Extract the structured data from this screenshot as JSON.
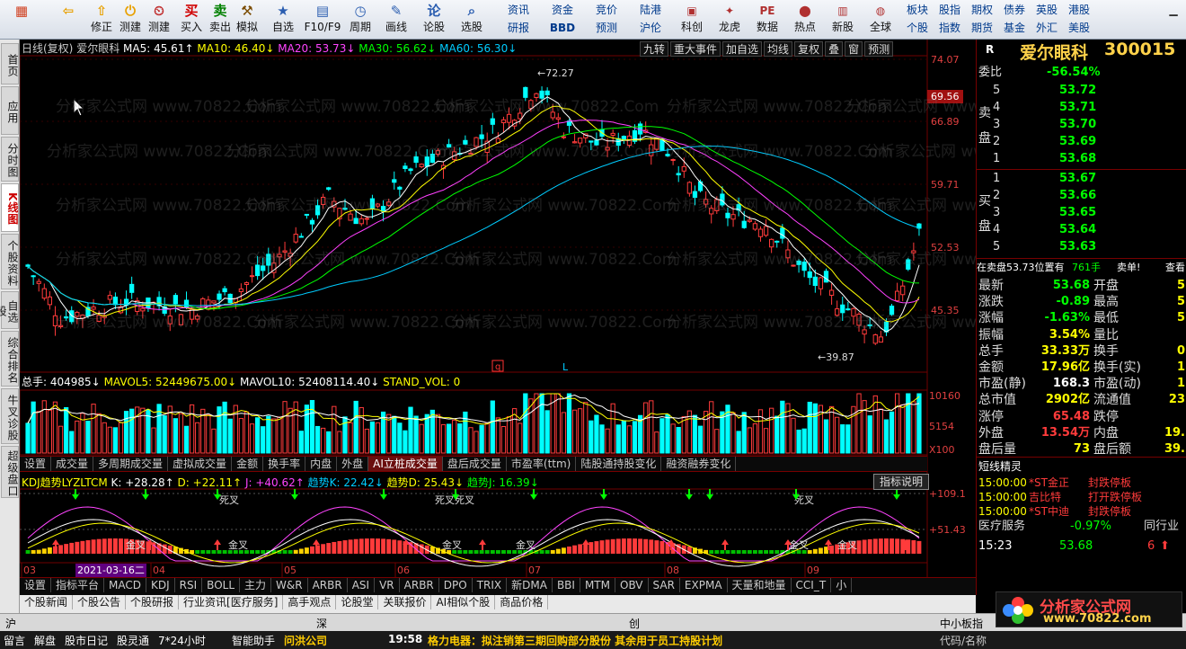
{
  "toolbar": {
    "buttons": [
      {
        "label": "",
        "icon": "▦",
        "color": "#d04020"
      },
      {
        "label": "",
        "icon": "⇦",
        "color": "#e8a000"
      },
      {
        "label": "修正",
        "icon": "⇧",
        "color": "#e8a000"
      },
      {
        "label": "测建",
        "icon": "⏻",
        "color": "#e8a000"
      },
      {
        "label": "测建",
        "icon": "⏲",
        "color": "#c03030"
      },
      {
        "label": "买入",
        "icon": "买",
        "color": "#d00000"
      },
      {
        "label": "卖出",
        "icon": "卖",
        "color": "#008000"
      },
      {
        "label": "模拟",
        "icon": "⚒",
        "color": "#7a4b00"
      },
      {
        "label": "自选",
        "icon": "★",
        "color": "#2a5db0"
      },
      {
        "label": "F10/F9",
        "icon": "▤",
        "color": "#2a5db0"
      },
      {
        "label": "周期",
        "icon": "◷",
        "color": "#2a5db0"
      },
      {
        "label": "画线",
        "icon": "✎",
        "color": "#2a5db0"
      },
      {
        "label": "论股",
        "icon": "论",
        "color": "#2a5db0"
      },
      {
        "label": "选股",
        "icon": "⌕",
        "color": "#2a5db0"
      }
    ],
    "mini_top": [
      "资讯",
      "资金",
      "竞价",
      "陆港"
    ],
    "mini_bot": [
      "研报",
      "BBD",
      "预测",
      "沪伦"
    ],
    "buttons2": [
      {
        "label": "科创",
        "icon": "▣"
      },
      {
        "label": "龙虎",
        "icon": "✦"
      },
      {
        "label": "数据",
        "icon": "PE"
      },
      {
        "label": "热点",
        "icon": "⬤"
      },
      {
        "label": "新股",
        "icon": "▥"
      },
      {
        "label": "全球",
        "icon": "◍"
      }
    ],
    "mini2_top": [
      "板块",
      "股指",
      "期权",
      "债券",
      "英股",
      "港股"
    ],
    "mini2_bot": [
      "个股",
      "指数",
      "期货",
      "基金",
      "外汇",
      "美股"
    ]
  },
  "sidebar": {
    "tabs": [
      "首页",
      "应用",
      "分时图",
      "K线图",
      "个股资料",
      "自选股",
      "综合排名",
      "牛叉诊股",
      "超级盘口"
    ],
    "active": 3
  },
  "chart": {
    "header": {
      "period": "日线(复权)",
      "name": "爱尔眼科",
      "ma5": "MA5: 45.61↑",
      "ma10": "MA10: 46.40↓",
      "ma20": "MA20: 53.73↓",
      "ma30": "MA30: 56.62↓",
      "ma60": "MA60: 56.30↓"
    },
    "buttons": [
      "九转",
      "重大事件",
      "加自选",
      "均线",
      "复权",
      "叠",
      "窗",
      "预测"
    ],
    "price_axis": [
      "74.07",
      "66.89",
      "59.71",
      "52.53",
      "45.35"
    ],
    "price_badge": "69.56",
    "high_label": "72.27",
    "low_label": "39.87",
    "mark_q": "q",
    "mark_l": "L",
    "vol_header": {
      "total": "总手: 404985↓",
      "mavol5": "MAVOL5: 52449675.00↓",
      "mavol10": "MAVOL10: 52408114.40↓",
      "stand": "STAND_VOL: 0"
    },
    "vol_axis": [
      "10160",
      "5154",
      "X100"
    ],
    "tabs1": [
      "设置",
      "成交量",
      "多周期成交量",
      "虚拟成交量",
      "金额",
      "换手率",
      "内盘",
      "外盘",
      "AI立桩成交量",
      "盘后成交量",
      "市盈率(ttm)",
      "陆股通持股变化",
      "融资融券变化"
    ],
    "tabs1_active": 8,
    "kdj_header": {
      "name": "KDJ趋势LYZLTCM",
      "k": "K: +28.28↑",
      "d": "D: +22.11↑",
      "j": "J: +40.62↑",
      "tk": "趋势K: 22.42↓",
      "td": "趋势D: 25.43↓",
      "tj": "趋势J: 16.39↓"
    },
    "indicator_btn": "指标说明",
    "kdj_axis": [
      "+109.1",
      "+51.43"
    ],
    "cross_labels": [
      "金叉",
      "金叉",
      "金叉",
      "金叉",
      "金叉",
      "金叉",
      "死叉",
      "死叉死叉",
      "死叉"
    ],
    "date_axis": [
      "03",
      "04",
      "05",
      "06",
      "07",
      "08",
      "09"
    ],
    "date_highlight": "2021-03-16二",
    "tabs2": [
      "指标平台",
      "MACD",
      "KDJ",
      "RSI",
      "BOLL",
      "主力",
      "W&R",
      "ARBR",
      "ASI",
      "VR",
      "ARBR",
      "DPO",
      "TRIX",
      "新DMA",
      "BBI",
      "MTM",
      "OBV",
      "SAR",
      "EXPMA",
      "天量和地量",
      "CCI_T",
      "小"
    ],
    "tabs3": [
      "个股新闻",
      "个股公告",
      "个股研报",
      "行业资讯[医疗服务]",
      "高手观点",
      "论股堂",
      "关联报价",
      "AI相似个股",
      "商品价格"
    ]
  },
  "quote": {
    "flag": "R",
    "name": "爱尔眼科",
    "code": "300015",
    "weibi_label": "委比",
    "weibi": "-56.54%",
    "sell": [
      {
        "n": "5",
        "p": "53.72"
      },
      {
        "n": "4",
        "p": "53.71"
      },
      {
        "n": "3",
        "p": "53.70"
      },
      {
        "n": "2",
        "p": "53.69"
      },
      {
        "n": "1",
        "p": "53.68"
      }
    ],
    "buy": [
      {
        "n": "1",
        "p": "53.67"
      },
      {
        "n": "2",
        "p": "53.66"
      },
      {
        "n": "3",
        "p": "53.65"
      },
      {
        "n": "4",
        "p": "53.64"
      },
      {
        "n": "5",
        "p": "53.63"
      }
    ],
    "sell_side": [
      "卖",
      "盘"
    ],
    "buy_side": [
      "买",
      "盘"
    ],
    "zaimai": "在卖盘53.73位置有",
    "zaimai_vol": "761手",
    "zaimai_tag": "卖单!",
    "zaimai_more": "查看",
    "stats": [
      {
        "k1": "最新",
        "v1": "53.68",
        "k2": "开盘",
        "v2": "5"
      },
      {
        "k1": "涨跌",
        "v1": "-0.89",
        "k2": "最高",
        "v2": "5"
      },
      {
        "k1": "涨幅",
        "v1": "-1.63%",
        "k2": "最低",
        "v2": "5"
      },
      {
        "k1": "振幅",
        "v1": "3.54%",
        "k2": "量比",
        "v2": ""
      },
      {
        "k1": "总手",
        "v1": "33.33万",
        "k2": "换手",
        "v2": "0"
      },
      {
        "k1": "金额",
        "v1": "17.96亿",
        "k2": "换手(实)",
        "v2": "1"
      },
      {
        "k1": "市盈(静)",
        "v1": "168.3",
        "k2": "市盈(动)",
        "v2": "1"
      },
      {
        "k1": "总市值",
        "v1": "2902亿",
        "k2": "流通值",
        "v2": "23"
      },
      {
        "k1": "涨停",
        "v1": "65.48",
        "k2": "跌停",
        "v2": ""
      },
      {
        "k1": "外盘",
        "v1": "13.54万",
        "k2": "内盘",
        "v2": "19."
      },
      {
        "k1": "盘后量",
        "v1": "73",
        "k2": "盘后额",
        "v2": "39."
      }
    ],
    "jingling_title": "短线精灵",
    "jingling": [
      {
        "t": "15:00:00",
        "s": "*ST金正",
        "e": "封跌停板"
      },
      {
        "t": "15:00:00",
        "s": "吉比特",
        "e": "打开跌停板"
      },
      {
        "t": "15:00:00",
        "s": "*ST中迪",
        "e": "封跌停板"
      }
    ],
    "sector": "医疗服务",
    "sector_pct": "-0.97%",
    "sector_btn": "同行业",
    "last_time": "15:23",
    "last_price": "53.68",
    "last_vol": "6"
  },
  "status": {
    "market1": "沪",
    "market2": "深",
    "market3": "创",
    "market4": "中小板指",
    "tabs": [
      "留言",
      "解盘",
      "股市日记",
      "股灵通",
      "7*24小时",
      "智能助手"
    ],
    "news_src": "问洪公司",
    "news_time": "19:58",
    "news_text": "格力电器：拟注销第三期回购部分股份 其余用于员工持股计划",
    "right_tabs": [
      "代码/名称"
    ]
  },
  "watermark": {
    "text": "分析家公式网 www.70822.Com",
    "logo_text": "分析家公式网",
    "logo_url": "www.70822.com"
  },
  "colors": {
    "up": "#ff3b3b",
    "down": "#00ffff",
    "ma5": "#ffffff",
    "ma10": "#ffff00",
    "ma20": "#ff40ff",
    "ma30": "#00ff00",
    "ma60": "#00ccff",
    "axis": "#e04040",
    "grid": "#700000"
  }
}
